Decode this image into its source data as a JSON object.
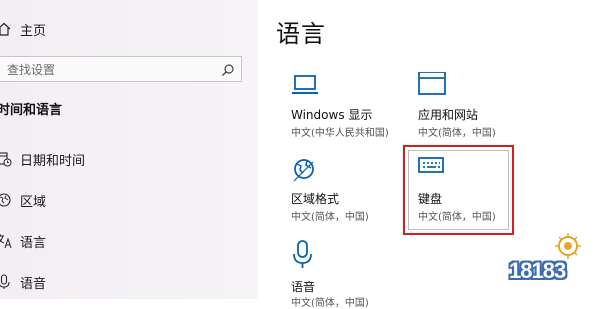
{
  "sidebar": {
    "home_label": "主页",
    "search_placeholder": "查找设置",
    "section_title": "时间和语言",
    "items": [
      {
        "label": "日期和时间",
        "icon": "calendar-clock-icon"
      },
      {
        "label": "区域",
        "icon": "region-globe-icon"
      },
      {
        "label": "语言",
        "icon": "language-icon"
      },
      {
        "label": "语音",
        "icon": "microphone-icon"
      }
    ]
  },
  "main": {
    "title": "语言",
    "tiles": [
      {
        "name": "Windows 显示",
        "sub": "中文(中华人民共和国)",
        "icon": "laptop-icon"
      },
      {
        "name": "应用和网站",
        "sub": "中文(简体，中国)",
        "icon": "window-icon"
      },
      {
        "name": "区域格式",
        "sub": "中文(简体，中国)",
        "icon": "globe-icon"
      },
      {
        "name": "键盘",
        "sub": "中文(简体，中国)",
        "icon": "keyboard-icon"
      },
      {
        "name": "语音",
        "sub": "中文(简体，中国)",
        "icon": "microphone-icon"
      }
    ]
  },
  "colors": {
    "accent": "#0a63b3",
    "highlight": "#d61e1e"
  },
  "watermark": {
    "text": "18183"
  }
}
